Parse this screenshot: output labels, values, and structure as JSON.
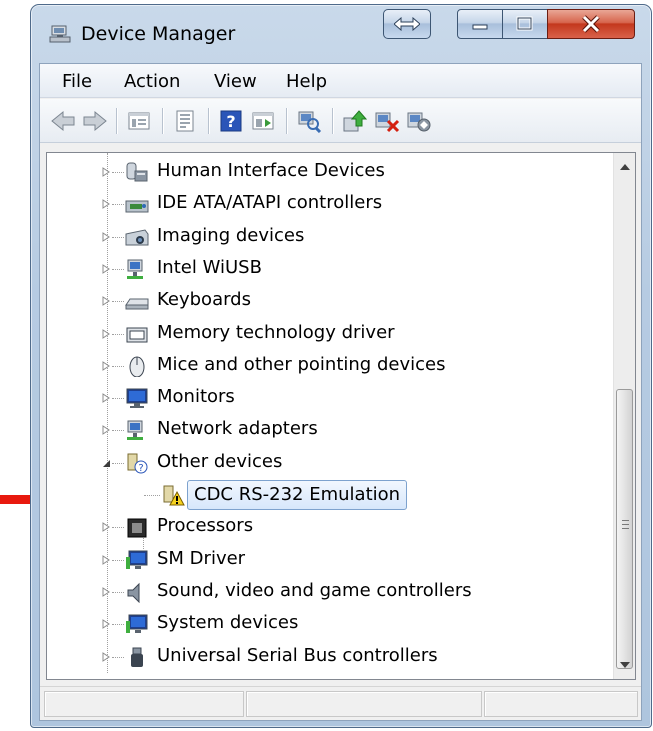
{
  "window": {
    "title": "Device Manager"
  },
  "menu": [
    "File",
    "Action",
    "View",
    "Help"
  ],
  "toolbar_icons": [
    "back-icon",
    "forward-icon",
    "show-hide-console-tree-icon",
    "properties-icon",
    "help-icon",
    "run-action-icon",
    "scan-hardware-changes-icon",
    "update-driver-icon",
    "uninstall-icon",
    "disable-icon"
  ],
  "tree": {
    "items": [
      {
        "label": "Human Interface Devices",
        "icon": "hid-icon",
        "expanded": false
      },
      {
        "label": "IDE ATA/ATAPI controllers",
        "icon": "ide-controller-icon",
        "expanded": false
      },
      {
        "label": "Imaging devices",
        "icon": "imaging-device-icon",
        "expanded": false
      },
      {
        "label": "Intel WiUSB",
        "icon": "network-icon",
        "expanded": false
      },
      {
        "label": "Keyboards",
        "icon": "keyboard-icon",
        "expanded": false
      },
      {
        "label": "Memory technology driver",
        "icon": "memory-icon",
        "expanded": false
      },
      {
        "label": "Mice and other pointing devices",
        "icon": "mouse-icon",
        "expanded": false
      },
      {
        "label": "Monitors",
        "icon": "monitor-icon",
        "expanded": false
      },
      {
        "label": "Network adapters",
        "icon": "network-adapter-icon",
        "expanded": false
      },
      {
        "label": "Other devices",
        "icon": "unknown-device-icon",
        "expanded": true
      },
      {
        "label": "CDC RS-232 Emulation",
        "icon": "warning-device-icon",
        "child": true,
        "selected": true
      },
      {
        "label": "Processors",
        "icon": "processor-icon",
        "expanded": false
      },
      {
        "label": "SM Driver",
        "icon": "sm-driver-icon",
        "expanded": false
      },
      {
        "label": "Sound, video and game controllers",
        "icon": "speaker-icon",
        "expanded": false
      },
      {
        "label": "System devices",
        "icon": "system-device-icon",
        "expanded": false
      },
      {
        "label": "Universal Serial Bus controllers",
        "icon": "usb-icon",
        "expanded": false
      }
    ]
  },
  "colors": {
    "annotation_arrow": "#e8190e",
    "selection_border": "#7da2ce",
    "close_button": "#c3381d"
  }
}
